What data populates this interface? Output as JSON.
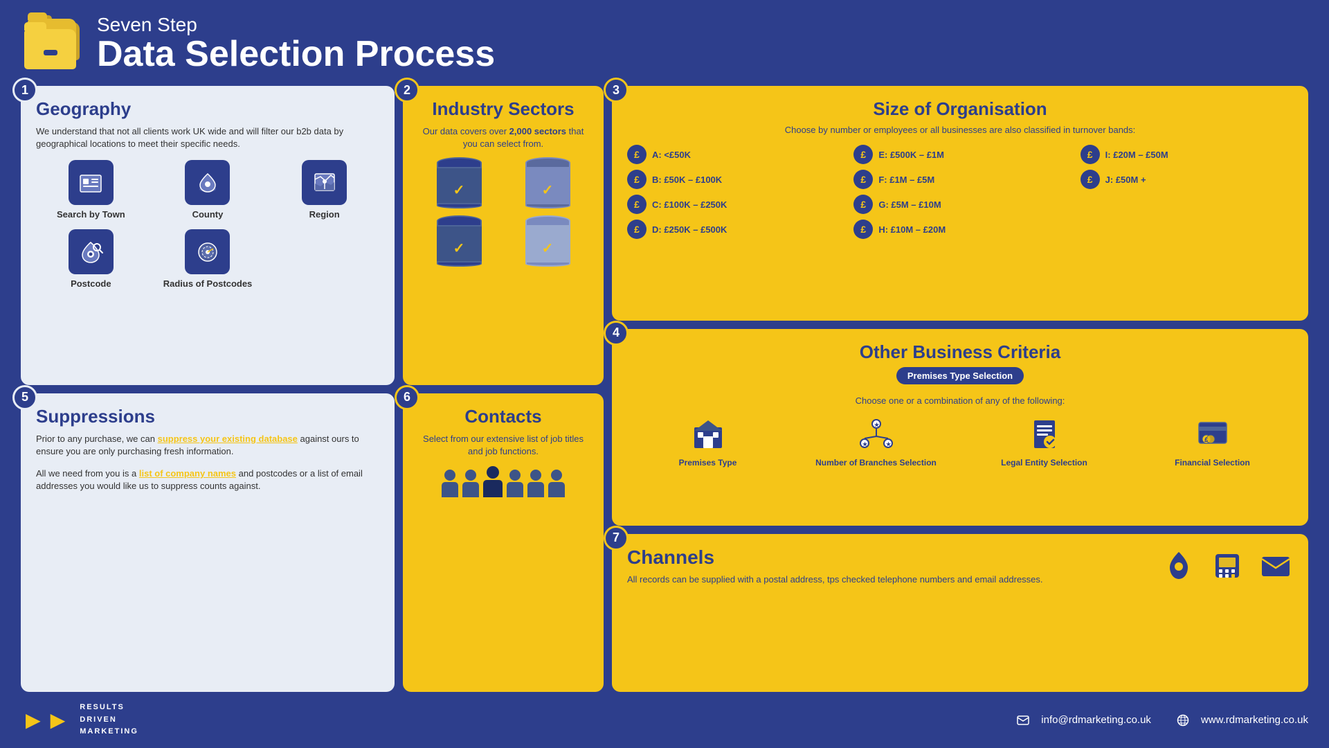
{
  "header": {
    "subtitle": "Seven Step",
    "title": "Data Selection Process"
  },
  "steps": {
    "geography": {
      "step": "1",
      "heading": "Geography",
      "text": "We understand that not all clients work UK wide and will filter our b2b data by geographical locations to meet their specific needs.",
      "icons": [
        {
          "label": "Search by Town",
          "icon": "building"
        },
        {
          "label": "County",
          "icon": "pin"
        },
        {
          "label": "Region",
          "icon": "region"
        },
        {
          "label": "Postcode",
          "icon": "postcode"
        },
        {
          "label": "Radius of Postcodes",
          "icon": "radius"
        }
      ]
    },
    "industry": {
      "step": "2",
      "heading": "Industry Sectors",
      "text_pre": "Our data covers over ",
      "text_highlight": "2,000 sectors",
      "text_post": " that you can select from."
    },
    "size": {
      "step": "3",
      "heading": "Size of Organisation",
      "subtext": "Choose by number or employees or all businesses are also classified in turnover bands:",
      "bands": [
        {
          "id": "A",
          "label": "A: <£50K"
        },
        {
          "id": "B",
          "label": "B: £50K – £100K"
        },
        {
          "id": "C",
          "label": "C: £100K – £250K"
        },
        {
          "id": "D",
          "label": "D: £250K – £500K"
        },
        {
          "id": "E",
          "label": "E: £500K – £1M"
        },
        {
          "id": "F",
          "label": "F: £1M – £5M"
        },
        {
          "id": "G",
          "label": "G: £5M – £10M"
        },
        {
          "id": "H",
          "label": "H: £10M – £20M"
        },
        {
          "id": "I",
          "label": "I: £20M – £50M"
        },
        {
          "id": "J",
          "label": "J: £50M +"
        }
      ]
    },
    "suppressions": {
      "step": "5",
      "heading": "Suppressions",
      "text1_pre": "Prior to any purchase, we can ",
      "text1_link": "suppress your existing database",
      "text1_post": " against ours to ensure you are only purchasing fresh information.",
      "text2_pre": "All we need from you is a ",
      "text2_link": "list of company names",
      "text2_post": " and postcodes or a list of email addresses you would like us to suppress counts against."
    },
    "contacts": {
      "step": "6",
      "heading": "Contacts",
      "text": "Select from our extensive list of job titles and job functions."
    },
    "other_business": {
      "step": "4",
      "heading": "Other Business Criteria",
      "badge": "Premises Type Selection",
      "choose_text": "Choose one or a combination of any of the following:",
      "icons": [
        {
          "label": "Premises Type",
          "icon": "building"
        },
        {
          "label": "Number of Branches Selection",
          "icon": "branches"
        },
        {
          "label": "Legal Entity Selection",
          "icon": "legal"
        },
        {
          "label": "Financial Selection",
          "icon": "financial"
        }
      ]
    },
    "channels": {
      "step": "7",
      "heading": "Channels",
      "text": "All records can be supplied with a postal address, tps checked telephone numbers and email addresses."
    }
  },
  "footer": {
    "company": "RESULTS\nDRIVEN\nMARKETING",
    "email": "info@rdmarketing.co.uk",
    "website": "www.rdmarketing.co.uk"
  }
}
